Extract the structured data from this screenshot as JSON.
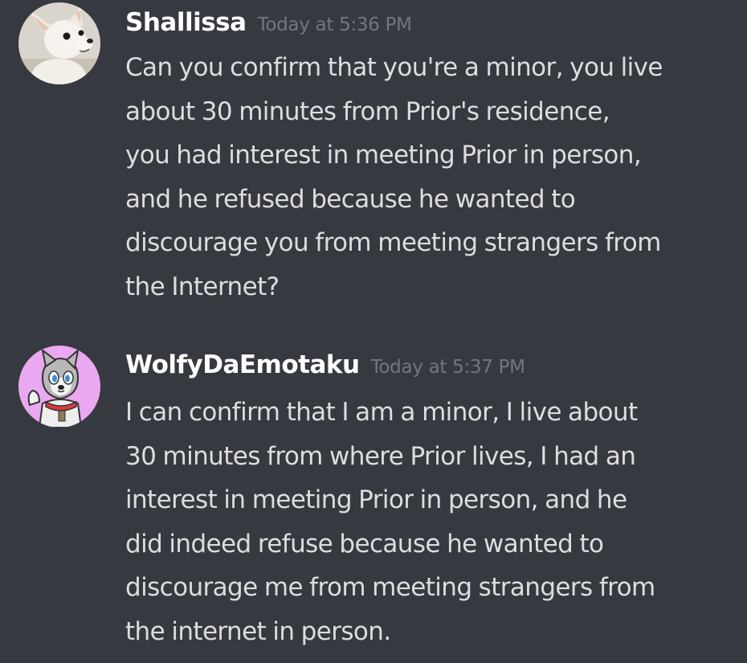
{
  "messages": [
    {
      "username": "Shallissa",
      "timestamp": "Today at 5:36 PM",
      "avatar_icon": "chihuahua-avatar-icon",
      "lines": [
        "Can you confirm that you're a minor, you live",
        "about 30 minutes from Prior's residence,",
        "you had interest in meeting Prior in person,",
        "and he refused because he wanted to",
        "discourage you from meeting strangers from",
        "the Internet?"
      ]
    },
    {
      "username": "WolfyDaEmotaku",
      "timestamp": "Today at 5:37 PM",
      "avatar_icon": "cartoon-wolf-avatar-icon",
      "lines": [
        "I can confirm that I am a minor, I live about",
        "30 minutes from where Prior lives, I had an",
        "interest in meeting Prior in person, and he",
        "did indeed refuse because he wanted to",
        "discourage me from meeting strangers from",
        "the internet in person."
      ]
    }
  ],
  "colors": {
    "background": "#36393f",
    "username": "#ffffff",
    "timestamp": "#72767d",
    "message_text": "#dcddde"
  }
}
